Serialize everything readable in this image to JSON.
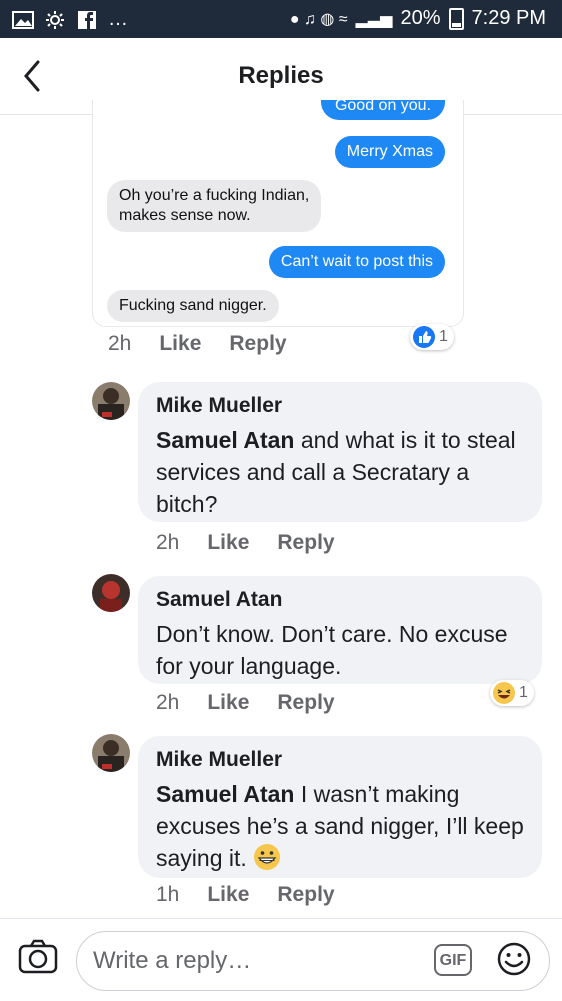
{
  "status_bar": {
    "battery": "20%",
    "time": "7:29 PM",
    "more": "…"
  },
  "header": {
    "title": "Replies"
  },
  "screenshot": {
    "messages": [
      {
        "side": "right",
        "text": "Good on you."
      },
      {
        "side": "right",
        "text": "Merry Xmas"
      },
      {
        "side": "left",
        "text": "Oh you’re a fucking Indian,\nmakes sense now."
      },
      {
        "side": "right",
        "text": "Can’t wait to post this"
      },
      {
        "side": "left",
        "text": "Fucking sand nigger."
      }
    ]
  },
  "top_actions": {
    "time": "2h",
    "like": "Like",
    "reply": "Reply",
    "reaction_count": "1"
  },
  "comments": [
    {
      "author": "Mike Mueller",
      "mention": "Samuel Atan",
      "text": " and what is it to steal services and call a Secratary a bitch?",
      "time": "2h",
      "like": "Like",
      "reply": "Reply"
    },
    {
      "author": "Samuel Atan",
      "mention": "",
      "text": "Don’t know. Don’t care. No excuse for your language.",
      "time": "2h",
      "like": "Like",
      "reply": "Reply",
      "reaction_count": "1"
    },
    {
      "author": "Mike Mueller",
      "mention": "Samuel Atan",
      "text": " I wasn’t making excuses he’s a sand nigger, I’ll keep saying it.",
      "time": "1h",
      "like": "Like",
      "reply": "Reply"
    }
  ],
  "composer": {
    "placeholder": "Write a reply…",
    "gif": "GIF"
  },
  "colors": {
    "blue_bubble": "#1e88f5",
    "comment_bg": "#f0f2f5",
    "like_blue": "#1877f2"
  }
}
